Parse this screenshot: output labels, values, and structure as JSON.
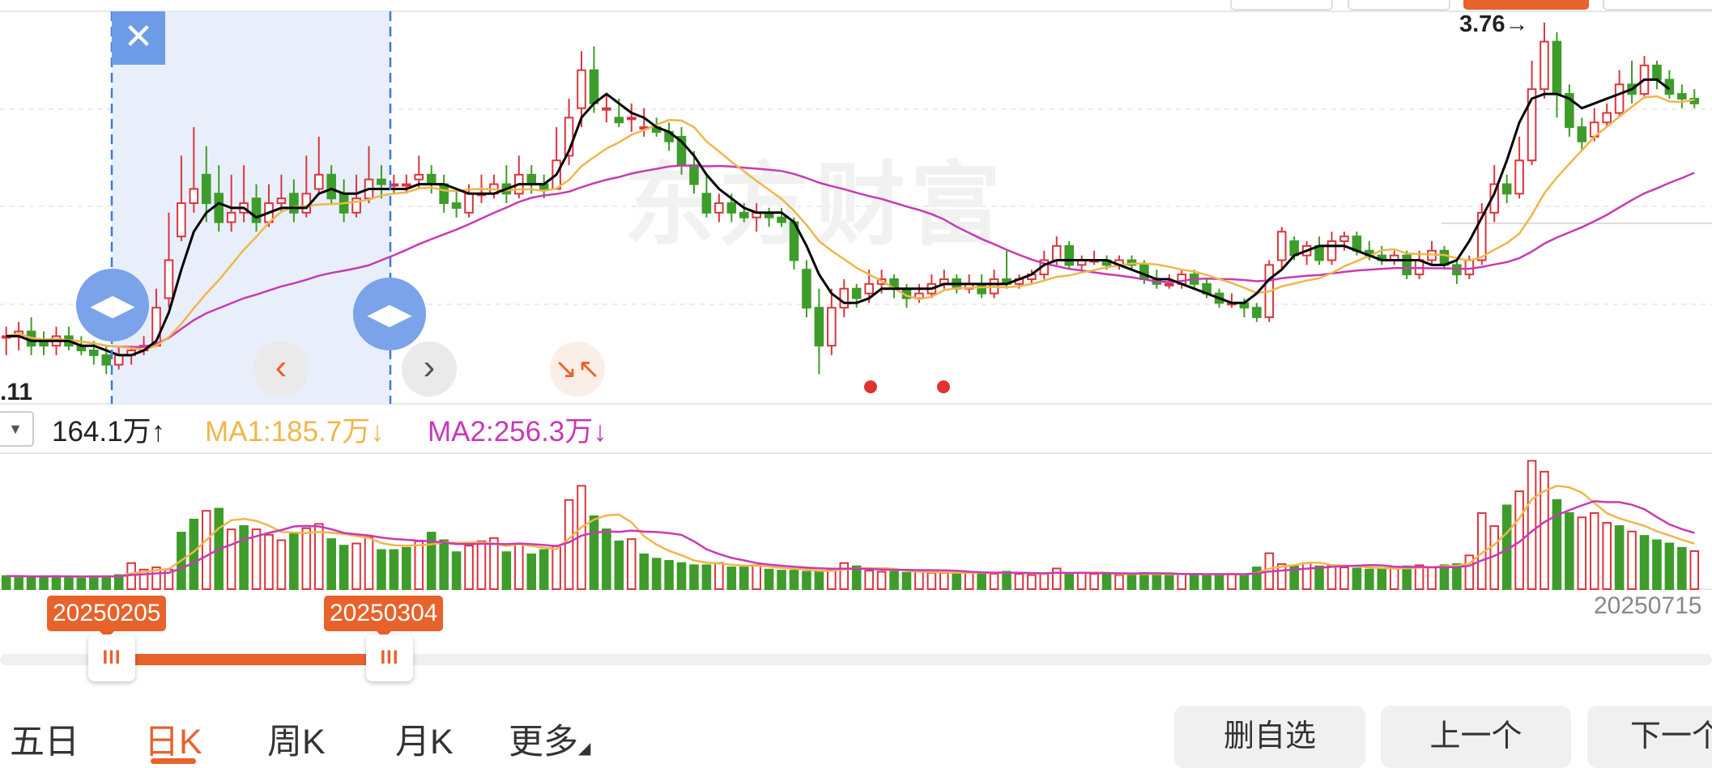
{
  "chart_data": {
    "type": "candlestick",
    "max_price_label": "3.76→",
    "min_price_label": ".11",
    "watermark": "东方财富",
    "end_date_label": "20250715",
    "volume_legend": {
      "current": "164.1万",
      "current_arrow": "↑",
      "ma1": "MA1:185.7万",
      "ma1_arrow": "↓",
      "ma2": "MA2:256.3万",
      "ma2_arrow": "↓"
    },
    "colors": {
      "up": "#d9363e",
      "down": "#3e9c2a",
      "ma_short": "#000000",
      "ma1": "#f0b64a",
      "ma2": "#c83ab4",
      "accent": "#e8622c",
      "selection": "#3b7be0"
    },
    "candles": [
      [
        3.14,
        3.14,
        3.16,
        3.1
      ],
      [
        3.14,
        3.15,
        3.17,
        3.11
      ],
      [
        3.15,
        3.12,
        3.18,
        3.1
      ],
      [
        3.13,
        3.12,
        3.15,
        3.1
      ],
      [
        3.12,
        3.14,
        3.16,
        3.1
      ],
      [
        3.14,
        3.12,
        3.16,
        3.11
      ],
      [
        3.12,
        3.11,
        3.14,
        3.1
      ],
      [
        3.11,
        3.1,
        3.13,
        3.08
      ],
      [
        3.1,
        3.08,
        3.12,
        3.06
      ],
      [
        3.08,
        3.1,
        3.12,
        3.07
      ],
      [
        3.1,
        3.11,
        3.12,
        3.08
      ],
      [
        3.11,
        3.12,
        3.14,
        3.1
      ],
      [
        3.12,
        3.2,
        3.24,
        3.12
      ],
      [
        3.22,
        3.3,
        3.4,
        3.2
      ],
      [
        3.35,
        3.42,
        3.52,
        3.34
      ],
      [
        3.42,
        3.45,
        3.58,
        3.4
      ],
      [
        3.48,
        3.42,
        3.54,
        3.38
      ],
      [
        3.44,
        3.38,
        3.5,
        3.36
      ],
      [
        3.38,
        3.4,
        3.48,
        3.36
      ],
      [
        3.4,
        3.42,
        3.5,
        3.38
      ],
      [
        3.43,
        3.38,
        3.46,
        3.36
      ],
      [
        3.38,
        3.42,
        3.46,
        3.37
      ],
      [
        3.42,
        3.43,
        3.48,
        3.4
      ],
      [
        3.44,
        3.4,
        3.47,
        3.38
      ],
      [
        3.4,
        3.44,
        3.52,
        3.39
      ],
      [
        3.45,
        3.48,
        3.56,
        3.44
      ],
      [
        3.48,
        3.43,
        3.5,
        3.42
      ],
      [
        3.44,
        3.4,
        3.47,
        3.38
      ],
      [
        3.4,
        3.43,
        3.48,
        3.39
      ],
      [
        3.43,
        3.47,
        3.54,
        3.42
      ],
      [
        3.47,
        3.46,
        3.5,
        3.43
      ],
      [
        3.46,
        3.46,
        3.48,
        3.44
      ],
      [
        3.46,
        3.46,
        3.48,
        3.44
      ],
      [
        3.47,
        3.48,
        3.52,
        3.45
      ],
      [
        3.48,
        3.46,
        3.5,
        3.44
      ],
      [
        3.46,
        3.42,
        3.48,
        3.4
      ],
      [
        3.42,
        3.41,
        3.45,
        3.39
      ],
      [
        3.4,
        3.44,
        3.46,
        3.39
      ],
      [
        3.44,
        3.44,
        3.48,
        3.42
      ],
      [
        3.44,
        3.46,
        3.48,
        3.43
      ],
      [
        3.46,
        3.44,
        3.5,
        3.42
      ],
      [
        3.44,
        3.48,
        3.52,
        3.43
      ],
      [
        3.48,
        3.46,
        3.5,
        3.44
      ],
      [
        3.46,
        3.45,
        3.48,
        3.43
      ],
      [
        3.45,
        3.51,
        3.58,
        3.45
      ],
      [
        3.52,
        3.6,
        3.64,
        3.5
      ],
      [
        3.62,
        3.7,
        3.74,
        3.58
      ],
      [
        3.7,
        3.63,
        3.75,
        3.61
      ],
      [
        3.62,
        3.62,
        3.65,
        3.59
      ],
      [
        3.6,
        3.59,
        3.64,
        3.58
      ],
      [
        3.6,
        3.6,
        3.63,
        3.57
      ],
      [
        3.58,
        3.58,
        3.62,
        3.56
      ],
      [
        3.58,
        3.57,
        3.6,
        3.56
      ],
      [
        3.57,
        3.55,
        3.59,
        3.53
      ],
      [
        3.56,
        3.5,
        3.58,
        3.48
      ],
      [
        3.5,
        3.46,
        3.53,
        3.44
      ],
      [
        3.44,
        3.4,
        3.48,
        3.39
      ],
      [
        3.4,
        3.42,
        3.44,
        3.38
      ],
      [
        3.42,
        3.4,
        3.44,
        3.38
      ],
      [
        3.4,
        3.39,
        3.42,
        3.38
      ],
      [
        3.39,
        3.4,
        3.42,
        3.36
      ],
      [
        3.4,
        3.39,
        3.41,
        3.37
      ],
      [
        3.39,
        3.38,
        3.41,
        3.37
      ],
      [
        3.38,
        3.3,
        3.39,
        3.28
      ],
      [
        3.28,
        3.2,
        3.3,
        3.18
      ],
      [
        3.2,
        3.12,
        3.24,
        3.06
      ],
      [
        3.12,
        3.2,
        3.24,
        3.1
      ],
      [
        3.2,
        3.24,
        3.26,
        3.18
      ],
      [
        3.24,
        3.22,
        3.25,
        3.2
      ],
      [
        3.23,
        3.25,
        3.28,
        3.21
      ],
      [
        3.25,
        3.26,
        3.28,
        3.23
      ],
      [
        3.26,
        3.24,
        3.27,
        3.22
      ],
      [
        3.24,
        3.22,
        3.25,
        3.2
      ],
      [
        3.22,
        3.23,
        3.25,
        3.21
      ],
      [
        3.23,
        3.25,
        3.27,
        3.22
      ],
      [
        3.25,
        3.26,
        3.28,
        3.24
      ],
      [
        3.26,
        3.24,
        3.27,
        3.23
      ],
      [
        3.24,
        3.25,
        3.27,
        3.23
      ],
      [
        3.25,
        3.23,
        3.27,
        3.22
      ],
      [
        3.23,
        3.26,
        3.28,
        3.22
      ],
      [
        3.26,
        3.25,
        3.32,
        3.24
      ],
      [
        3.25,
        3.26,
        3.27,
        3.24
      ],
      [
        3.26,
        3.27,
        3.28,
        3.25
      ],
      [
        3.27,
        3.3,
        3.32,
        3.26
      ],
      [
        3.3,
        3.33,
        3.35,
        3.29
      ],
      [
        3.33,
        3.29,
        3.34,
        3.28
      ],
      [
        3.29,
        3.3,
        3.31,
        3.28
      ],
      [
        3.3,
        3.3,
        3.32,
        3.29
      ],
      [
        3.3,
        3.29,
        3.31,
        3.28
      ],
      [
        3.29,
        3.3,
        3.31,
        3.28
      ],
      [
        3.3,
        3.29,
        3.31,
        3.28
      ],
      [
        3.29,
        3.26,
        3.3,
        3.25
      ],
      [
        3.26,
        3.25,
        3.28,
        3.24
      ],
      [
        3.25,
        3.25,
        3.27,
        3.24
      ],
      [
        3.25,
        3.27,
        3.28,
        3.24
      ],
      [
        3.27,
        3.25,
        3.28,
        3.24
      ],
      [
        3.25,
        3.23,
        3.26,
        3.22
      ],
      [
        3.23,
        3.21,
        3.24,
        3.2
      ],
      [
        3.21,
        3.21,
        3.23,
        3.2
      ],
      [
        3.21,
        3.2,
        3.22,
        3.18
      ],
      [
        3.2,
        3.18,
        3.21,
        3.17
      ],
      [
        3.18,
        3.29,
        3.3,
        3.17
      ],
      [
        3.3,
        3.36,
        3.37,
        3.28
      ],
      [
        3.34,
        3.31,
        3.35,
        3.3
      ],
      [
        3.31,
        3.33,
        3.34,
        3.29
      ],
      [
        3.33,
        3.3,
        3.35,
        3.29
      ],
      [
        3.3,
        3.34,
        3.36,
        3.29
      ],
      [
        3.34,
        3.35,
        3.36,
        3.32
      ],
      [
        3.35,
        3.32,
        3.36,
        3.31
      ],
      [
        3.32,
        3.31,
        3.34,
        3.3
      ],
      [
        3.31,
        3.3,
        3.33,
        3.29
      ],
      [
        3.3,
        3.31,
        3.32,
        3.29
      ],
      [
        3.31,
        3.27,
        3.32,
        3.26
      ],
      [
        3.27,
        3.3,
        3.32,
        3.26
      ],
      [
        3.3,
        3.32,
        3.34,
        3.29
      ],
      [
        3.32,
        3.29,
        3.33,
        3.28
      ],
      [
        3.29,
        3.27,
        3.3,
        3.25
      ],
      [
        3.27,
        3.3,
        3.31,
        3.26
      ],
      [
        3.3,
        3.4,
        3.42,
        3.29
      ],
      [
        3.4,
        3.46,
        3.5,
        3.38
      ],
      [
        3.46,
        3.44,
        3.48,
        3.42
      ],
      [
        3.44,
        3.51,
        3.56,
        3.43
      ],
      [
        3.51,
        3.66,
        3.72,
        3.5
      ],
      [
        3.66,
        3.76,
        3.8,
        3.64
      ],
      [
        3.76,
        3.65,
        3.78,
        3.6
      ],
      [
        3.65,
        3.58,
        3.67,
        3.56
      ],
      [
        3.58,
        3.55,
        3.6,
        3.53
      ],
      [
        3.56,
        3.59,
        3.62,
        3.55
      ],
      [
        3.59,
        3.61,
        3.63,
        3.58
      ],
      [
        3.61,
        3.67,
        3.7,
        3.6
      ],
      [
        3.67,
        3.65,
        3.72,
        3.63
      ],
      [
        3.65,
        3.71,
        3.73,
        3.64
      ],
      [
        3.71,
        3.68,
        3.72,
        3.66
      ],
      [
        3.68,
        3.65,
        3.7,
        3.64
      ],
      [
        3.65,
        3.64,
        3.67,
        3.62
      ],
      [
        3.64,
        3.63,
        3.66,
        3.62
      ]
    ],
    "ma_short": [
      3.14,
      3.14,
      3.13,
      3.13,
      3.13,
      3.13,
      3.12,
      3.12,
      3.11,
      3.1,
      3.1,
      3.11,
      3.13,
      3.19,
      3.28,
      3.36,
      3.4,
      3.42,
      3.41,
      3.41,
      3.39,
      3.4,
      3.41,
      3.41,
      3.41,
      3.44,
      3.45,
      3.44,
      3.44,
      3.45,
      3.45,
      3.45,
      3.45,
      3.46,
      3.46,
      3.46,
      3.45,
      3.44,
      3.44,
      3.44,
      3.45,
      3.46,
      3.46,
      3.46,
      3.48,
      3.53,
      3.6,
      3.63,
      3.65,
      3.63,
      3.61,
      3.6,
      3.58,
      3.57,
      3.55,
      3.52,
      3.48,
      3.45,
      3.43,
      3.41,
      3.4,
      3.4,
      3.4,
      3.38,
      3.33,
      3.27,
      3.23,
      3.21,
      3.21,
      3.22,
      3.24,
      3.24,
      3.24,
      3.24,
      3.24,
      3.25,
      3.25,
      3.25,
      3.25,
      3.25,
      3.25,
      3.26,
      3.27,
      3.29,
      3.3,
      3.3,
      3.3,
      3.3,
      3.3,
      3.29,
      3.28,
      3.27,
      3.26,
      3.26,
      3.25,
      3.24,
      3.23,
      3.22,
      3.21,
      3.21,
      3.23,
      3.26,
      3.28,
      3.31,
      3.32,
      3.33,
      3.33,
      3.33,
      3.32,
      3.31,
      3.3,
      3.3,
      3.3,
      3.3,
      3.29,
      3.29,
      3.3,
      3.34,
      3.39,
      3.44,
      3.51,
      3.59,
      3.64,
      3.65,
      3.65,
      3.64,
      3.62,
      3.63,
      3.64,
      3.65,
      3.66,
      3.68,
      3.68,
      3.66
    ]
  },
  "volume": {
    "up": [
      0,
      0,
      0,
      0,
      0,
      0,
      0,
      0,
      0,
      0,
      1,
      1,
      1,
      1,
      0,
      0,
      1,
      0,
      1,
      0,
      1,
      1,
      1,
      0,
      1,
      1,
      0,
      0,
      1,
      1,
      0,
      0,
      0,
      1,
      0,
      0,
      0,
      1,
      1,
      1,
      0,
      1,
      0,
      0,
      1,
      1,
      1,
      0,
      0,
      0,
      1,
      0,
      0,
      0,
      0,
      0,
      0,
      1,
      0,
      0,
      1,
      0,
      0,
      0,
      0,
      0,
      1,
      1,
      0,
      1,
      1,
      0,
      0,
      1,
      1,
      1,
      0,
      1,
      0,
      1,
      0,
      1,
      1,
      1,
      1,
      0,
      1,
      1,
      0,
      1,
      0,
      0,
      0,
      0,
      1,
      0,
      0,
      0,
      1,
      0,
      0,
      1,
      1,
      0,
      1,
      0,
      1,
      1,
      0,
      0,
      0,
      1,
      0,
      1,
      1,
      0,
      0,
      1,
      1,
      1,
      0,
      1,
      1,
      1,
      0,
      0,
      1,
      1,
      1,
      0,
      1,
      0,
      0,
      0,
      0,
      1
    ],
    "values": [
      12,
      12,
      11,
      12,
      12,
      11,
      11,
      12,
      12,
      13,
      24,
      18,
      20,
      18,
      52,
      64,
      72,
      74,
      55,
      58,
      55,
      50,
      45,
      52,
      56,
      60,
      46,
      40,
      42,
      48,
      36,
      36,
      38,
      44,
      52,
      45,
      34,
      40,
      44,
      47,
      34,
      42,
      32,
      36,
      40,
      82,
      95,
      67,
      55,
      44,
      46,
      32,
      28,
      26,
      24,
      22,
      22,
      24,
      20,
      20,
      22,
      18,
      17,
      17,
      16,
      16,
      18,
      24,
      21,
      17,
      16,
      16,
      15,
      16,
      15,
      15,
      14,
      16,
      15,
      14,
      16,
      14,
      13,
      14,
      19,
      14,
      15,
      14,
      14,
      13,
      14,
      15,
      14,
      13,
      14,
      14,
      13,
      14,
      14,
      13,
      20,
      33,
      23,
      21,
      24,
      21,
      22,
      20,
      19,
      18,
      18,
      20,
      21,
      22,
      20,
      22,
      23,
      31,
      70,
      58,
      77,
      90,
      118,
      108,
      82,
      70,
      66,
      70,
      61,
      58,
      53,
      49,
      45,
      42,
      38,
      35
    ]
  },
  "overlay": {
    "close_icon": "close-icon",
    "start_date": "20250205",
    "end_date": "20250304",
    "handle_grip": "III"
  },
  "tabs": [
    {
      "label": "五日"
    },
    {
      "label": "日K"
    },
    {
      "label": "周K"
    },
    {
      "label": "月K"
    },
    {
      "label": "更多"
    }
  ],
  "actions": {
    "remove_watchlist": "删自选",
    "previous": "上一个",
    "next": "下一个"
  }
}
